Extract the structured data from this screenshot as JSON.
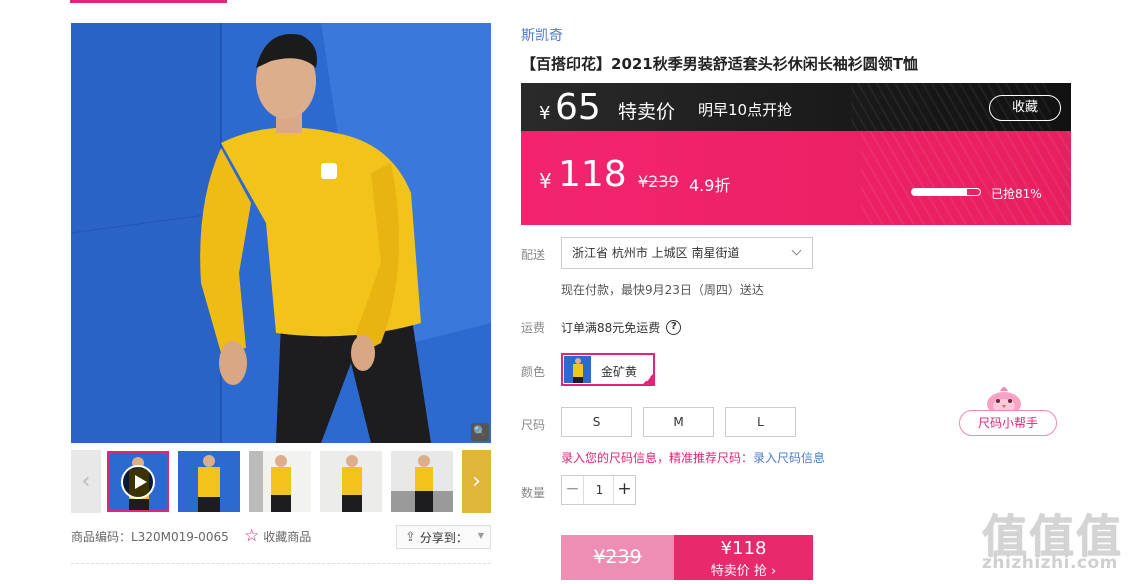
{
  "brand": "斯凯奇",
  "product": {
    "title": "【百搭印花】2021秋季男装舒适套头衫休闲长袖衫圆领T恤",
    "code": "商品编码：L320M019-0065"
  },
  "gallery": {
    "favorite_label": "收藏商品",
    "share_label": "分享到："
  },
  "pre_sale": {
    "currency": "¥",
    "price": "65",
    "tag": "特卖价",
    "time": "明早10点开抢",
    "collect_label": "收藏"
  },
  "price": {
    "currency": "¥",
    "current": "118",
    "original": "¥239",
    "discount": "4.9折",
    "sold_progress": 0.81,
    "sold_label": "已抢81%"
  },
  "delivery": {
    "label": "配送",
    "address": "浙江省 杭州市 上城区 南星街道",
    "note": "现在付款，最快9月23日（周四）送达"
  },
  "freight": {
    "label": "运费",
    "text": "订单满88元免运费"
  },
  "color": {
    "label": "颜色",
    "selected": "金矿黄"
  },
  "size": {
    "label": "尺码",
    "options": [
      "S",
      "M",
      "L"
    ],
    "help_text": "录入您的尺码信息，精准推荐尺码：",
    "help_link": "录入尺码信息",
    "helper_label": "尺码小帮手"
  },
  "quantity": {
    "label": "数量",
    "value": "1"
  },
  "buy": {
    "original_price": "¥239",
    "price": "¥118",
    "label": "特卖价 抢 ›"
  },
  "watermark": {
    "logo": "值值值",
    "text": "zhizhizhi.com"
  }
}
